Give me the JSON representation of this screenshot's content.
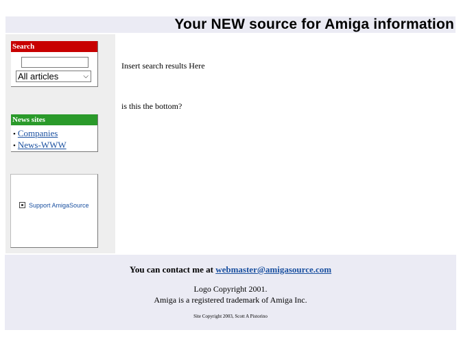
{
  "header": {
    "title": "Your NEW source for Amiga information"
  },
  "sidebar": {
    "search": {
      "title": "Search",
      "input_value": "",
      "select_value": "All articles"
    },
    "news": {
      "title": "News sites",
      "items": [
        {
          "label": "Companies"
        },
        {
          "label": "News-WWW"
        }
      ]
    },
    "support": {
      "link_label": "Support AmigaSource"
    }
  },
  "main": {
    "search_results": "Insert search results Here",
    "bottom_text": "is this the bottom?"
  },
  "footer": {
    "contact_prefix": "You can contact me at ",
    "contact_email": "webmaster@amigasource.com",
    "logo_copyright": "Logo Copyright 2001.",
    "trademark": "Amiga is a registered trademark of Amiga Inc.",
    "site_copyright": "Site Copyright 2003, Scott A Pistorino"
  },
  "colors": {
    "search_header": "#c80000",
    "news_header": "#2a9a2a",
    "link": "#1a50a0",
    "banner_bg": "#ebebf4",
    "sidebar_bg": "#eeeeee"
  }
}
